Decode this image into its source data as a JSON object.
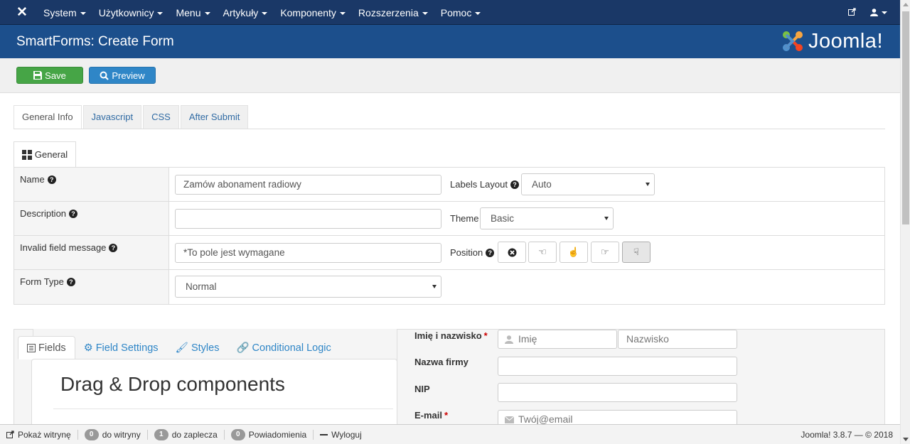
{
  "topnav": {
    "menu": [
      "System",
      "Użytkownicy",
      "Menu",
      "Artykuły",
      "Komponenty",
      "Rozszerzenia",
      "Pomoc"
    ]
  },
  "page": {
    "title": "SmartForms: Create Form",
    "brand": "Joomla!"
  },
  "toolbar": {
    "save_label": "Save",
    "preview_label": "Preview"
  },
  "tabs": [
    "General Info",
    "Javascript",
    "CSS",
    "After Submit"
  ],
  "subtab": "General",
  "form": {
    "name_label": "Name",
    "name_value": "Zamów abonament radiowy",
    "description_label": "Description",
    "description_value": "",
    "invalid_label": "Invalid field message",
    "invalid_value": "*To pole jest wymagane",
    "formtype_label": "Form Type",
    "formtype_value": "Normal",
    "labels_layout_label": "Labels Layout",
    "labels_layout_value": "Auto",
    "theme_label": "Theme",
    "theme_value": "Basic",
    "position_label": "Position"
  },
  "builder": {
    "tabs": [
      "Fields",
      "Field Settings",
      "Styles",
      "Conditional Logic"
    ],
    "heading": "Drag & Drop components"
  },
  "preview": {
    "name_label": "Imię i nazwisko",
    "first_placeholder": "Imię",
    "last_placeholder": "Nazwisko",
    "company_label": "Nazwa firmy",
    "nip_label": "NIP",
    "email_label": "E-mail",
    "email_placeholder": "Twój@email"
  },
  "statusbar": {
    "view_site": "Pokaż witrynę",
    "site_count": "0",
    "site_label": "do witryny",
    "admin_count": "1",
    "admin_label": "do zaplecza",
    "notif_count": "0",
    "notif_label": "Powiadomienia",
    "logout": "Wyloguj",
    "version": "Joomla! 3.8.7 — © 2018"
  }
}
